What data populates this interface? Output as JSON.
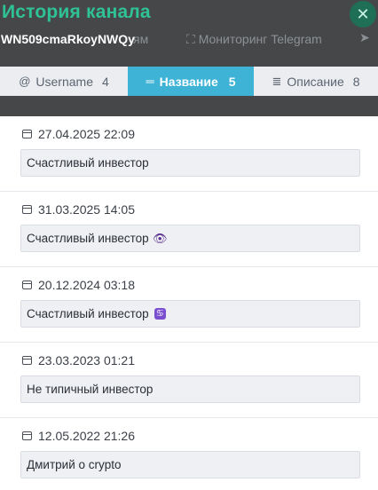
{
  "modal": {
    "title": "История канала",
    "channel_id": "WN509cmaRkoyNWQy",
    "close_glyph": "✕"
  },
  "underlay_nav": {
    "item_partial": "ям",
    "monitoring_icon": "⛶",
    "monitoring_label": "Мониторинг Telegram",
    "trailing_icon": "➤"
  },
  "tabs": [
    {
      "icon": "@",
      "label": "Username",
      "count": "4",
      "active": false
    },
    {
      "icon": "═",
      "label": "Название",
      "count": "5",
      "active": true
    },
    {
      "icon": "≣",
      "label": "Описание",
      "count": "8",
      "active": false
    }
  ],
  "entries": [
    {
      "date": "27.04.2025 22:09",
      "name": "Счастливый инвестор",
      "badge": ""
    },
    {
      "date": "31.03.2025 14:05",
      "name": "Счастливый инвестор",
      "badge": "👁"
    },
    {
      "date": "20.12.2024 03:18",
      "name": "Счастливый инвестор",
      "badge": "♋"
    },
    {
      "date": "23.03.2023 01:21",
      "name": "Не типичный инвестор",
      "badge": ""
    },
    {
      "date": "12.05.2022 21:26",
      "name": "Дмитрий о crypto",
      "badge": ""
    }
  ],
  "colors": {
    "accent_green": "#2fc294",
    "active_tab": "#3fb3d6"
  }
}
